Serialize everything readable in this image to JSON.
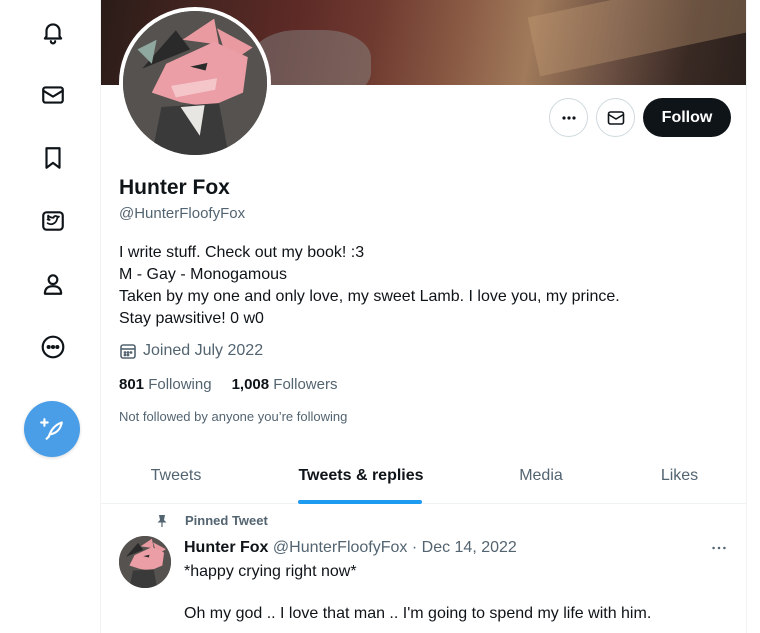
{
  "nav": {
    "items": [
      {
        "name": "notifications",
        "icon": "bell-icon"
      },
      {
        "name": "messages",
        "icon": "mail-icon"
      },
      {
        "name": "bookmarks",
        "icon": "bookmark-icon"
      },
      {
        "name": "twitter-blue",
        "icon": "twitter-blue-icon"
      },
      {
        "name": "profile",
        "icon": "person-icon"
      },
      {
        "name": "more",
        "icon": "more-circle-icon"
      }
    ],
    "compose_icon": "feather-plus-icon"
  },
  "profile": {
    "name": "Hunter Fox",
    "handle": "@HunterFloofyFox",
    "bio": [
      "I write stuff. Check out my book! :3",
      "M - Gay - Monogamous",
      "Taken by my one and only love, my sweet Lamb. I love you, my prince.",
      "Stay pawsitive! 0 w0"
    ],
    "joined": "Joined July 2022",
    "following_count": "801",
    "following_label": "Following",
    "followers_count": "1,008",
    "followers_label": "Followers",
    "not_followed_text": "Not followed by anyone you’re following",
    "follow_label": "Follow"
  },
  "tabs": [
    {
      "label": "Tweets",
      "active": false
    },
    {
      "label": "Tweets & replies",
      "active": true
    },
    {
      "label": "Media",
      "active": false
    },
    {
      "label": "Likes",
      "active": false
    }
  ],
  "tweet": {
    "pinned_label": "Pinned Tweet",
    "author": "Hunter Fox",
    "meta": "@HunterFloofyFox · Dec 14, 2022",
    "line1": "*happy crying right now*",
    "line2": "Oh my god .. I love that man .. I'm going to spend my life with him."
  },
  "colors": {
    "accent": "#1d9bf0",
    "compose": "#4a9ee8",
    "follow_button": "#0f1419",
    "secondary_text": "#536471"
  }
}
